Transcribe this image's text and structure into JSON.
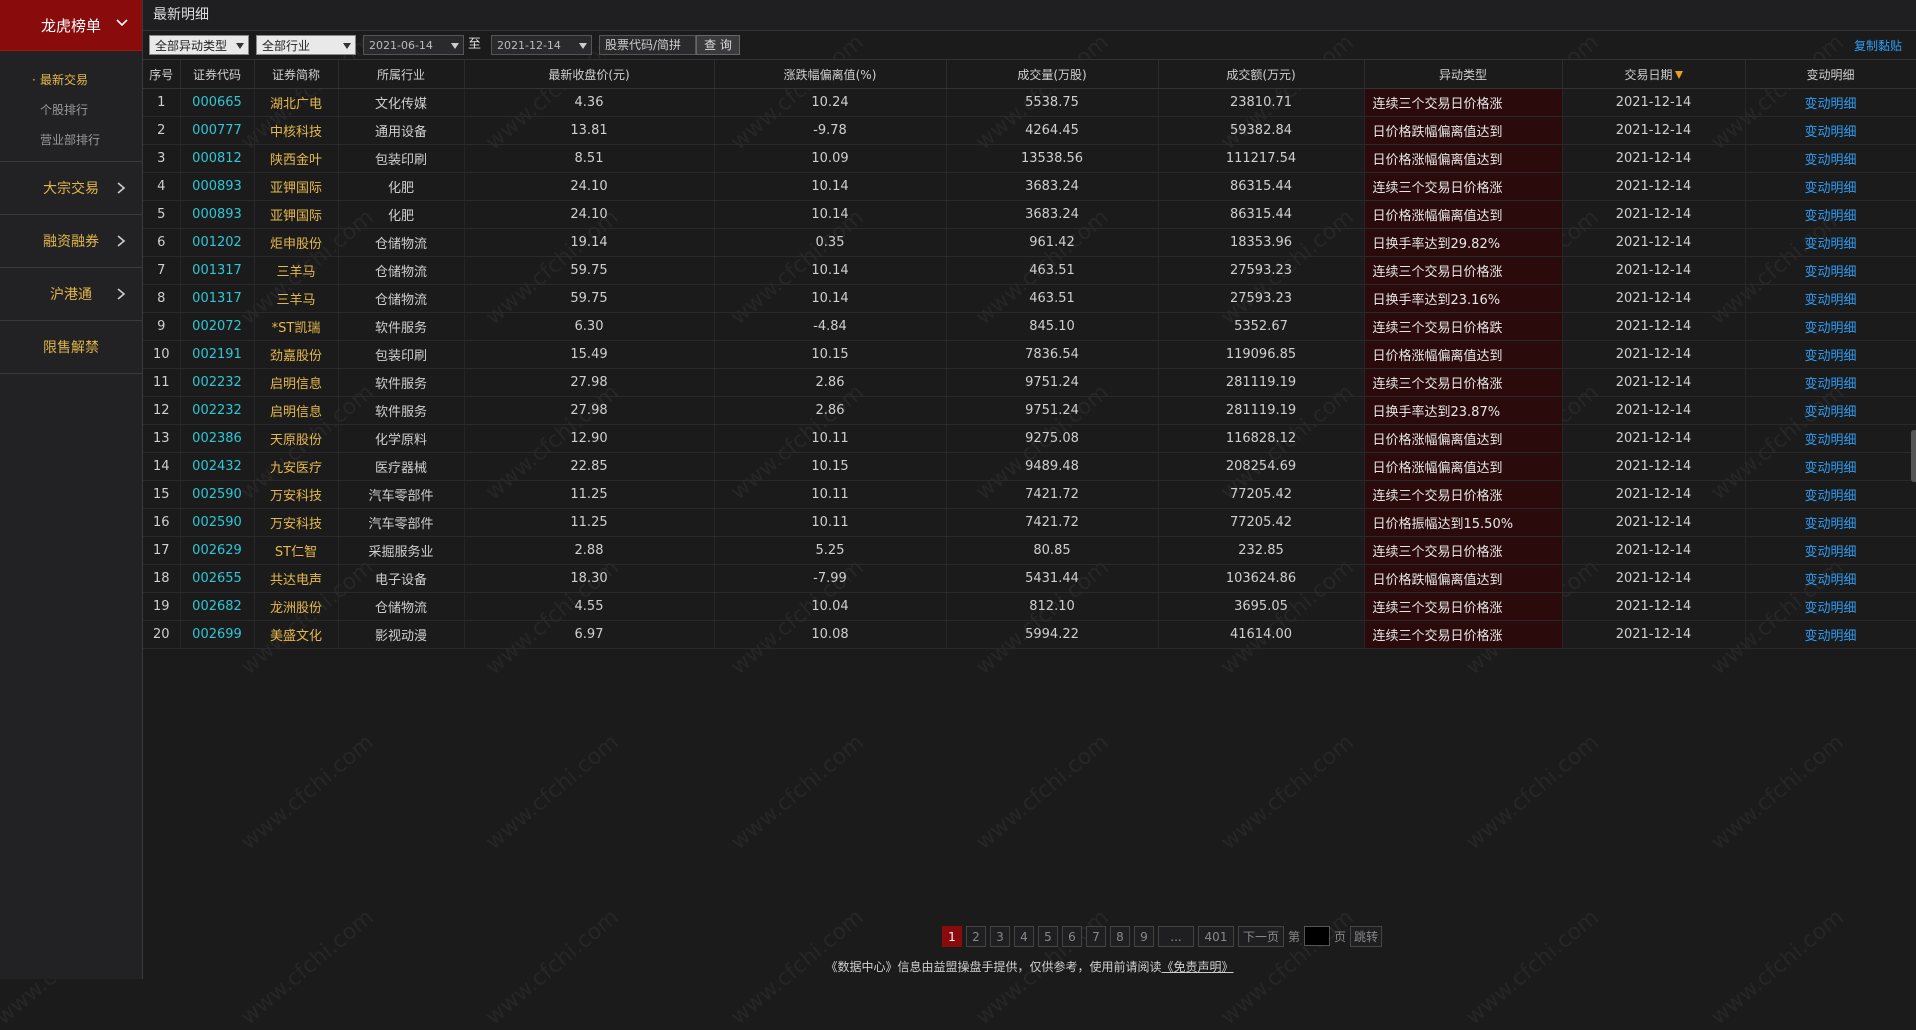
{
  "sidebar": {
    "header": "龙虎榜单",
    "sub_items": [
      "最新交易",
      "个股排行",
      "营业部排行"
    ],
    "items": [
      "大宗交易",
      "融资融券",
      "沪港通",
      "限售解禁"
    ]
  },
  "page_title": "最新明细",
  "filters": {
    "abnormal_type": "全部异动类型",
    "industry": "全部行业",
    "date_from": "2021-06-14",
    "to_label": "至",
    "date_to": "2021-12-14",
    "search_placeholder": "股票代码/简拼",
    "query_label": "查 询",
    "copy_label": "复制黏贴"
  },
  "table": {
    "headers": [
      "序号",
      "证券代码",
      "证券简称",
      "所属行业",
      "最新收盘价(元)",
      "涨跌幅偏离值(%)",
      "成交量(万股)",
      "成交额(万元)",
      "异动类型",
      "交易日期",
      "变动明细"
    ],
    "rows": [
      [
        "1",
        "000665",
        "湖北广电",
        "文化传媒",
        "4.36",
        "10.24",
        "5538.75",
        "23810.71",
        "连续三个交易日价格涨",
        "2021-12-14",
        "变动明细"
      ],
      [
        "2",
        "000777",
        "中核科技",
        "通用设备",
        "13.81",
        "-9.78",
        "4264.45",
        "59382.84",
        "日价格跌幅偏离值达到",
        "2021-12-14",
        "变动明细"
      ],
      [
        "3",
        "000812",
        "陕西金叶",
        "包装印刷",
        "8.51",
        "10.09",
        "13538.56",
        "111217.54",
        "日价格涨幅偏离值达到",
        "2021-12-14",
        "变动明细"
      ],
      [
        "4",
        "000893",
        "亚钾国际",
        "化肥",
        "24.10",
        "10.14",
        "3683.24",
        "86315.44",
        "连续三个交易日价格涨",
        "2021-12-14",
        "变动明细"
      ],
      [
        "5",
        "000893",
        "亚钾国际",
        "化肥",
        "24.10",
        "10.14",
        "3683.24",
        "86315.44",
        "日价格涨幅偏离值达到",
        "2021-12-14",
        "变动明细"
      ],
      [
        "6",
        "001202",
        "炬申股份",
        "仓储物流",
        "19.14",
        "0.35",
        "961.42",
        "18353.96",
        "日换手率达到29.82%",
        "2021-12-14",
        "变动明细"
      ],
      [
        "7",
        "001317",
        "三羊马",
        "仓储物流",
        "59.75",
        "10.14",
        "463.51",
        "27593.23",
        "连续三个交易日价格涨",
        "2021-12-14",
        "变动明细"
      ],
      [
        "8",
        "001317",
        "三羊马",
        "仓储物流",
        "59.75",
        "10.14",
        "463.51",
        "27593.23",
        "日换手率达到23.16%",
        "2021-12-14",
        "变动明细"
      ],
      [
        "9",
        "002072",
        "*ST凯瑞",
        "软件服务",
        "6.30",
        "-4.84",
        "845.10",
        "5352.67",
        "连续三个交易日价格跌",
        "2021-12-14",
        "变动明细"
      ],
      [
        "10",
        "002191",
        "劲嘉股份",
        "包装印刷",
        "15.49",
        "10.15",
        "7836.54",
        "119096.85",
        "日价格涨幅偏离值达到",
        "2021-12-14",
        "变动明细"
      ],
      [
        "11",
        "002232",
        "启明信息",
        "软件服务",
        "27.98",
        "2.86",
        "9751.24",
        "281119.19",
        "连续三个交易日价格涨",
        "2021-12-14",
        "变动明细"
      ],
      [
        "12",
        "002232",
        "启明信息",
        "软件服务",
        "27.98",
        "2.86",
        "9751.24",
        "281119.19",
        "日换手率达到23.87%",
        "2021-12-14",
        "变动明细"
      ],
      [
        "13",
        "002386",
        "天原股份",
        "化学原料",
        "12.90",
        "10.11",
        "9275.08",
        "116828.12",
        "日价格涨幅偏离值达到",
        "2021-12-14",
        "变动明细"
      ],
      [
        "14",
        "002432",
        "九安医疗",
        "医疗器械",
        "22.85",
        "10.15",
        "9489.48",
        "208254.69",
        "日价格涨幅偏离值达到",
        "2021-12-14",
        "变动明细"
      ],
      [
        "15",
        "002590",
        "万安科技",
        "汽车零部件",
        "11.25",
        "10.11",
        "7421.72",
        "77205.42",
        "连续三个交易日价格涨",
        "2021-12-14",
        "变动明细"
      ],
      [
        "16",
        "002590",
        "万安科技",
        "汽车零部件",
        "11.25",
        "10.11",
        "7421.72",
        "77205.42",
        "日价格振幅达到15.50%",
        "2021-12-14",
        "变动明细"
      ],
      [
        "17",
        "002629",
        "ST仁智",
        "采掘服务业",
        "2.88",
        "5.25",
        "80.85",
        "232.85",
        "连续三个交易日价格涨",
        "2021-12-14",
        "变动明细"
      ],
      [
        "18",
        "002655",
        "共达电声",
        "电子设备",
        "18.30",
        "-7.99",
        "5431.44",
        "103624.86",
        "日价格跌幅偏离值达到",
        "2021-12-14",
        "变动明细"
      ],
      [
        "19",
        "002682",
        "龙洲股份",
        "仓储物流",
        "4.55",
        "10.04",
        "812.10",
        "3695.05",
        "连续三个交易日价格涨",
        "2021-12-14",
        "变动明细"
      ],
      [
        "20",
        "002699",
        "美盛文化",
        "影视动漫",
        "6.97",
        "10.08",
        "5994.22",
        "41614.00",
        "连续三个交易日价格涨",
        "2021-12-14",
        "变动明细"
      ]
    ]
  },
  "pagination": {
    "pages": [
      "1",
      "2",
      "3",
      "4",
      "5",
      "6",
      "7",
      "8",
      "9",
      "...",
      "401"
    ],
    "current": "1",
    "next_label": "下一页",
    "goto_prefix": "第",
    "goto_suffix": "页",
    "jump_label": "跳转"
  },
  "footer": {
    "text": "《数据中心》信息由益盟操盘手提供，仅供参考，使用前请阅读",
    "disclaimer": "《免责声明》"
  },
  "watermark": "www.cfchi.com",
  "colors": {
    "brand_red": "#8a0b0b",
    "code_cyan": "#2ec7d6",
    "name_gold": "#e6b84c",
    "link_blue": "#2e9cf0",
    "abnormal_bg": "#2a0a0a"
  }
}
